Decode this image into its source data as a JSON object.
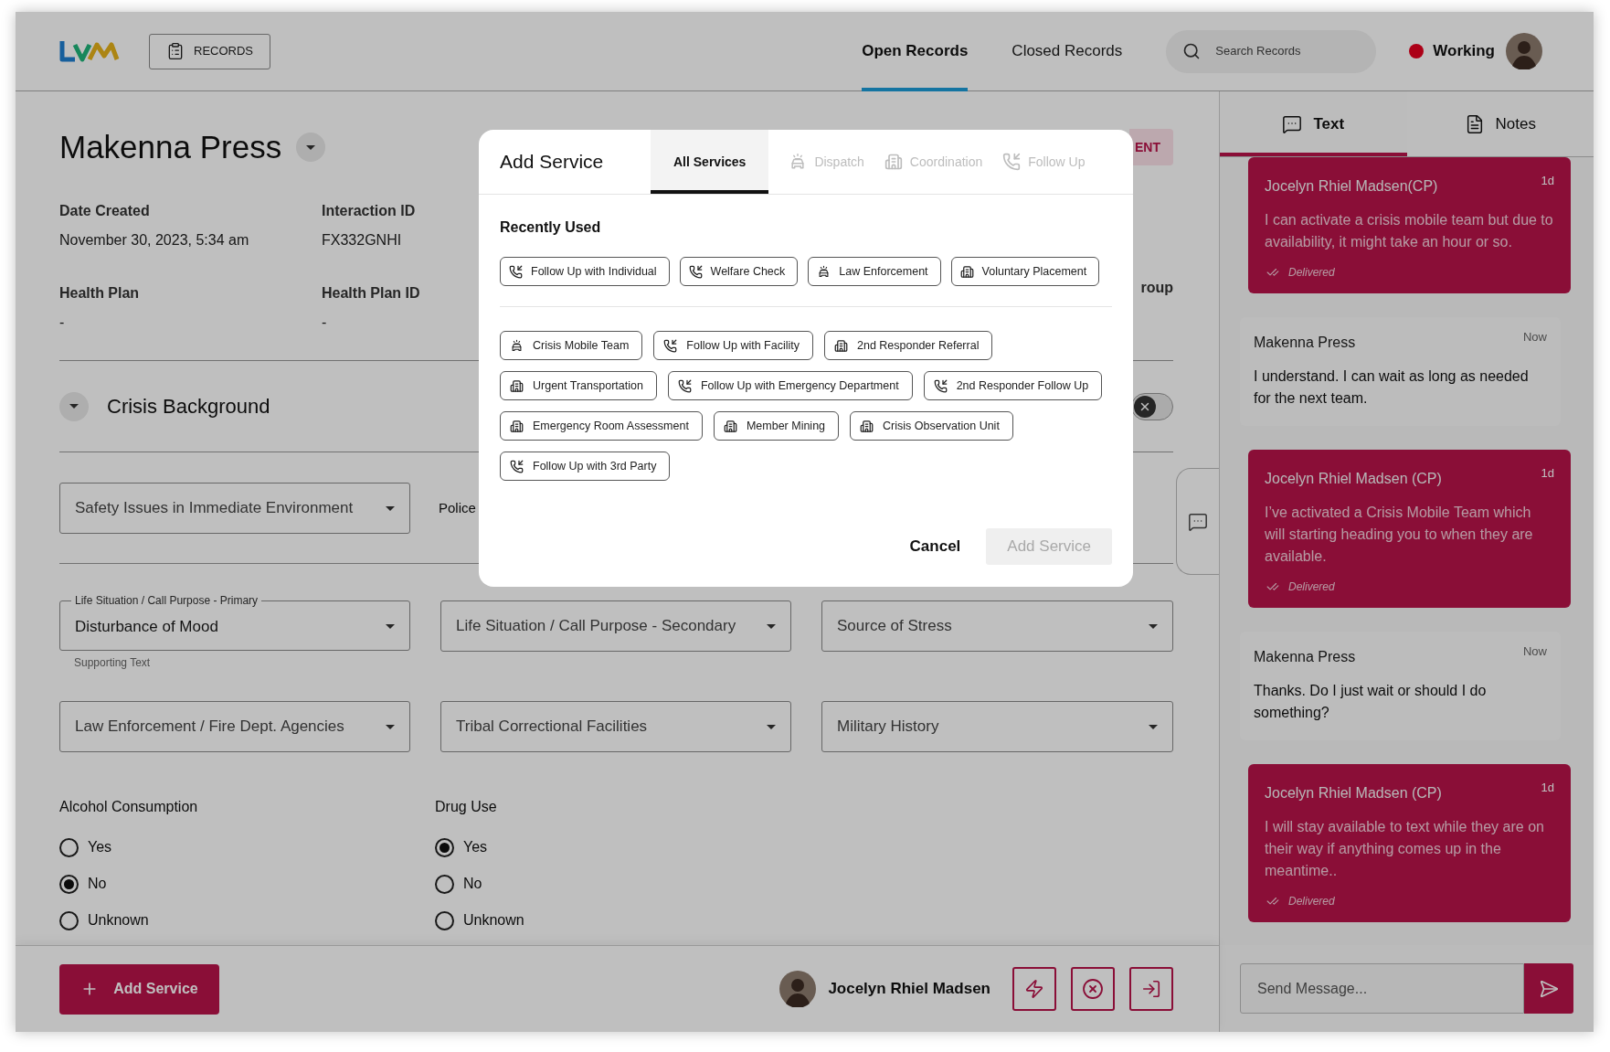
{
  "header": {
    "records_button": "RECORDS",
    "nav": [
      {
        "label": "Open Records",
        "selected": true
      },
      {
        "label": "Closed Records",
        "selected": false
      }
    ],
    "search": {
      "placeholder": "Search Records"
    },
    "status": "Working"
  },
  "record": {
    "name": "Makenna Press",
    "action_fragment": "ENT",
    "info": [
      {
        "label": "Date Created",
        "value": "November 30, 2023, 5:34 am"
      },
      {
        "label": "Interaction ID",
        "value": "FX332GNHI"
      },
      {
        "label": "Health Plan",
        "value": "-"
      },
      {
        "label": "Health Plan ID",
        "value": "-"
      }
    ],
    "info_fragment": "roup"
  },
  "crisis_background": {
    "title": "Crisis Background",
    "toggle": {
      "on": false
    },
    "safety_select": {
      "placeholder": "Safety Issues in Immediate Environment"
    },
    "police_fragment": "Police"
  },
  "selects": [
    {
      "label": "Life Situation / Call Purpose - Primary",
      "value": "Disturbance of Mood",
      "helper": "Supporting Text"
    },
    {
      "placeholder": "Life Situation / Call Purpose - Secondary"
    },
    {
      "placeholder": "Source of Stress"
    },
    {
      "placeholder": "Law Enforcement / Fire Dept. Agencies"
    },
    {
      "placeholder": "Tribal Correctional Facilities"
    },
    {
      "placeholder": "Military History"
    }
  ],
  "radio_groups": [
    {
      "label": "Alcohol Consumption",
      "options": [
        {
          "label": "Yes",
          "selected": false
        },
        {
          "label": "No",
          "selected": true
        },
        {
          "label": "Unknown",
          "selected": false
        }
      ]
    },
    {
      "label": "Drug Use",
      "options": [
        {
          "label": "Yes",
          "selected": true
        },
        {
          "label": "No",
          "selected": false
        },
        {
          "label": "Unknown",
          "selected": false
        }
      ]
    }
  ],
  "footer": {
    "add_button": "Add Service",
    "agent_name": "Jocelyn Rhiel Madsen"
  },
  "side_panel": {
    "tabs": [
      {
        "label": "Text",
        "kind": "chat",
        "selected": true
      },
      {
        "label": "Notes",
        "kind": "notes",
        "selected": false
      }
    ],
    "messages": [
      {
        "kind": "agent",
        "name": "Jocelyn Rhiel Madsen(CP)",
        "time": "1d",
        "text": "I can activate a crisis mobile team but due to availability, it might take an hour or so.",
        "status": "Delivered"
      },
      {
        "kind": "client",
        "name": "Makenna Press",
        "time": "Now",
        "text": "I understand. I can wait as long as needed for the next team."
      },
      {
        "kind": "agent",
        "name": "Jocelyn Rhiel Madsen (CP)",
        "time": "1d",
        "text": "I’ve activated a Crisis Mobile Team which will starting heading you to when they are available.",
        "status": "Delivered"
      },
      {
        "kind": "client",
        "name": "Makenna Press",
        "time": "Now",
        "text": "Thanks. Do I just wait or should I do something?"
      },
      {
        "kind": "agent",
        "name": "Jocelyn Rhiel Madsen (CP)",
        "time": "1d",
        "text": "I will stay available to text while they are on their way if anything comes up in the meantime..",
        "status": "Delivered"
      }
    ],
    "input": {
      "placeholder": "Send Message..."
    }
  },
  "modal": {
    "title": "Add Service",
    "tabs": [
      {
        "label": "All Services",
        "kind": "all",
        "selected": true,
        "disabled": false
      },
      {
        "label": "Dispatch",
        "kind": "car",
        "selected": false,
        "disabled": true
      },
      {
        "label": "Coordination",
        "kind": "building",
        "selected": false,
        "disabled": true
      },
      {
        "label": "Follow Up",
        "kind": "phone",
        "selected": false,
        "disabled": true
      }
    ],
    "section_title": "Recently Used",
    "recent": [
      {
        "label": "Follow Up with Individual",
        "kind": "phone"
      },
      {
        "label": "Welfare Check",
        "kind": "phone"
      },
      {
        "label": "Law Enforcement",
        "kind": "car"
      },
      {
        "label": "Voluntary Placement",
        "kind": "building"
      }
    ],
    "services": [
      {
        "label": "Crisis Mobile Team",
        "kind": "car"
      },
      {
        "label": "Follow Up with Facility",
        "kind": "phone"
      },
      {
        "label": "2nd Responder Referral",
        "kind": "building"
      },
      {
        "label": "Urgent Transportation",
        "kind": "building"
      },
      {
        "label": "Follow Up with Emergency Department",
        "kind": "phone"
      },
      {
        "label": "2nd Responder Follow Up",
        "kind": "phone"
      },
      {
        "label": "Emergency Room Assessment",
        "kind": "building"
      },
      {
        "label": "Member Mining",
        "kind": "building"
      },
      {
        "label": "Crisis Observation Unit",
        "kind": "building"
      },
      {
        "label": "Follow Up with 3rd Party",
        "kind": "phone"
      }
    ],
    "buttons": [
      {
        "label": "Cancel",
        "kind": "text",
        "disabled": false
      },
      {
        "label": "Add Service",
        "kind": "primary",
        "disabled": true
      }
    ]
  }
}
